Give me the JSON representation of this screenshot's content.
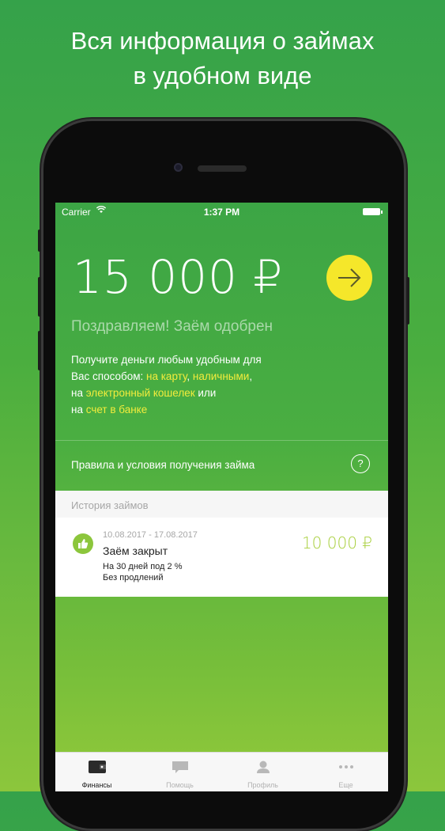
{
  "headline": {
    "line1": "Вся информация о займах",
    "line2": "в удобном виде"
  },
  "status_bar": {
    "carrier": "Carrier",
    "time": "1:37 PM"
  },
  "loan_offer": {
    "amount": "15 000 ₽",
    "approved_text": "Поздравляем! Заём одобрен",
    "description": {
      "line1": "Получите деньги любым удобным для",
      "line2_prefix": "Вас способом: ",
      "option_card": "на карту",
      "sep1": ", ",
      "option_cash": "наличными",
      "sep2": ",",
      "line3_prefix": "на ",
      "option_wallet": "электронный кошелек",
      "line3_suffix": " или",
      "line4_prefix": "на ",
      "option_bank": "счет в банке"
    }
  },
  "rules": {
    "label": "Правила и условия получения займа",
    "help_icon": "?"
  },
  "history": {
    "header": "История займов",
    "items": [
      {
        "dates": "10.08.2017 - 17.08.2017",
        "status": "Заём закрыт",
        "terms": "На 30 дней под 2 %",
        "extensions": "Без продлений",
        "amount": "10 000 ₽",
        "icon": "thumbs-up-icon"
      }
    ]
  },
  "tabbar": {
    "tabs": [
      {
        "label": "Финансы",
        "icon": "wallet-icon",
        "active": true
      },
      {
        "label": "Помощь",
        "icon": "chat-icon",
        "active": false
      },
      {
        "label": "Профиль",
        "icon": "person-icon",
        "active": false
      },
      {
        "label": "Еще",
        "icon": "more-icon",
        "active": false
      }
    ]
  },
  "colors": {
    "accent_yellow": "#f5e72a",
    "highlight_text": "#f3ec3c",
    "green_top": "#35a24a",
    "green_bottom": "#8cc63c",
    "loan_amount": "#a8cf3c"
  }
}
